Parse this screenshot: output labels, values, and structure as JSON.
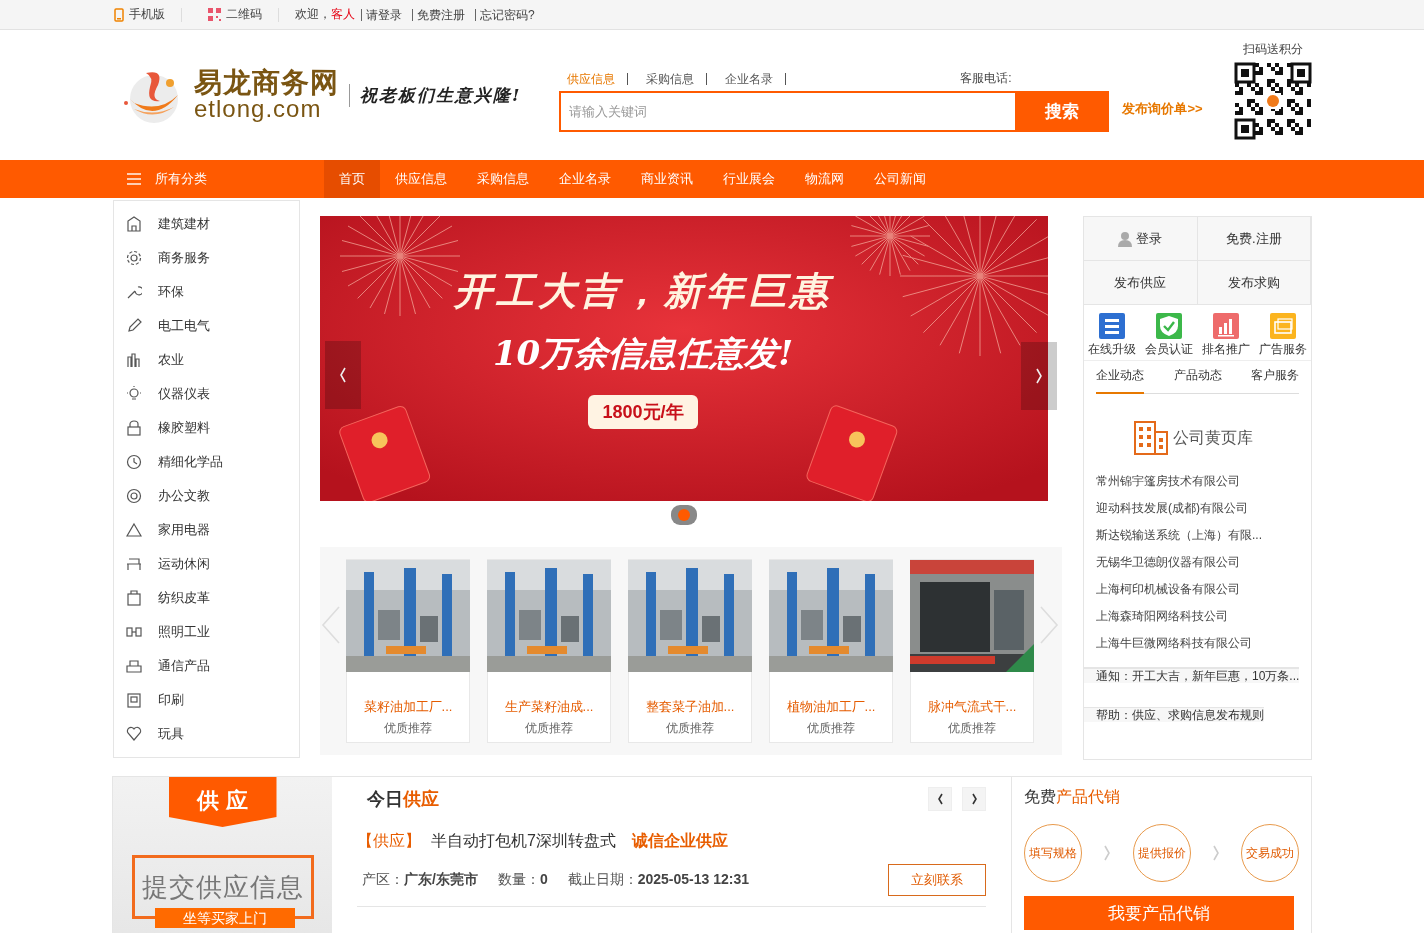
{
  "top_bar": {
    "mobile": "手机版",
    "qrcode": "二维码",
    "welcome": "欢迎，",
    "guest": "客人",
    "links": [
      "请登录",
      "免费注册",
      "忘记密码?"
    ]
  },
  "header": {
    "logo_cn": "易龙商务网",
    "logo_en": "etlong.com",
    "slogan": "祝老板们生意兴隆!",
    "search_tabs": [
      {
        "label": "供应信息",
        "selected": true
      },
      {
        "label": "采购信息",
        "selected": false
      },
      {
        "label": "企业名录",
        "selected": false
      }
    ],
    "hotline": "客服电话:",
    "search": {
      "placeholder": "请输入关键词"
    },
    "search_button": "搜索",
    "publish_link": "发布询价单>>",
    "qr_caption": "扫码送积分"
  },
  "nav": {
    "all": "所有分类",
    "items": [
      {
        "label": "首页",
        "selected": true
      },
      {
        "label": "供应信息",
        "selected": false
      },
      {
        "label": "采购信息",
        "selected": false
      },
      {
        "label": "企业名录",
        "selected": false
      },
      {
        "label": "商业资讯",
        "selected": false
      },
      {
        "label": "行业展会",
        "selected": false
      },
      {
        "label": "物流网",
        "selected": false
      },
      {
        "label": "公司新闻",
        "selected": false
      }
    ]
  },
  "categories": [
    "建筑建材",
    "商务服务",
    "环保",
    "电工电气",
    "农业",
    "仪器仪表",
    "橡胶塑料",
    "精细化学品",
    "办公文教",
    "家用电器",
    "运动休闲",
    "纺织皮革",
    "照明工业",
    "通信产品",
    "印刷",
    "玩具"
  ],
  "banner": {
    "headline": "开工大吉，新年巨惠",
    "subline": "10万余信息任意发!",
    "price": "1800元/年",
    "slides": [
      {
        "selected": true
      }
    ]
  },
  "products": [
    {
      "title": "菜籽油加工厂...",
      "note": "优质推荐"
    },
    {
      "title": "生产菜籽油成...",
      "note": "优质推荐"
    },
    {
      "title": "整套菜子油加...",
      "note": "优质推荐"
    },
    {
      "title": "植物油加工厂...",
      "note": "优质推荐"
    },
    {
      "title": "脉冲气流式干...",
      "note": "优质推荐"
    }
  ],
  "account": {
    "login": "登录",
    "register": "免费.注册",
    "post_supply": "发布供应",
    "post_demand": "发布求购"
  },
  "services": [
    {
      "kind": "upgrade",
      "label": "在线升级"
    },
    {
      "kind": "verify",
      "label": "会员认证"
    },
    {
      "kind": "rank",
      "label": "排名推广"
    },
    {
      "kind": "ads",
      "label": "广告服务"
    }
  ],
  "news_tabs": [
    {
      "label": "企业动态",
      "selected": true
    },
    {
      "label": "产品动态",
      "selected": false
    },
    {
      "label": "客户服务",
      "selected": false
    }
  ],
  "directory": {
    "title": "公司黄页库",
    "companies": [
      "常州锦宇篷房技术有限公司",
      "迎动科技发展(成都)有限公司",
      "斯达锐输送系统（上海）有限...",
      "无锡华卫德朗仪器有限公司",
      "上海柯印机械设备有限公司",
      "上海森琦阳网络科技公司",
      "上海牛巨微网络科技有限公司"
    ]
  },
  "notices": [
    "通知：开工大吉，新年巨惠，10万条...",
    "帮助：供应、求购信息发布规则"
  ],
  "supply_promo": {
    "ribbon": "供 应",
    "title": "提交供应信息",
    "subtitle": "坐等买家上门"
  },
  "today": {
    "title_prefix": "今日",
    "title_highlight": "供应",
    "tag": "【供应】",
    "name": "半自动打包机7深圳转盘式",
    "badge": "诚信企业供应",
    "meta": [
      {
        "label": "产区：",
        "value": "广东/东莞市"
      },
      {
        "label": "数量：",
        "value": "0"
      },
      {
        "label": "截止日期：",
        "value": "2025-05-13 12:31"
      }
    ],
    "contact": "立刻联系"
  },
  "consign": {
    "title_prefix": "免费",
    "title_highlight": "产品代销",
    "steps": [
      "填写规格",
      "提供报价",
      "交易成功"
    ],
    "button": "我要产品代销"
  }
}
